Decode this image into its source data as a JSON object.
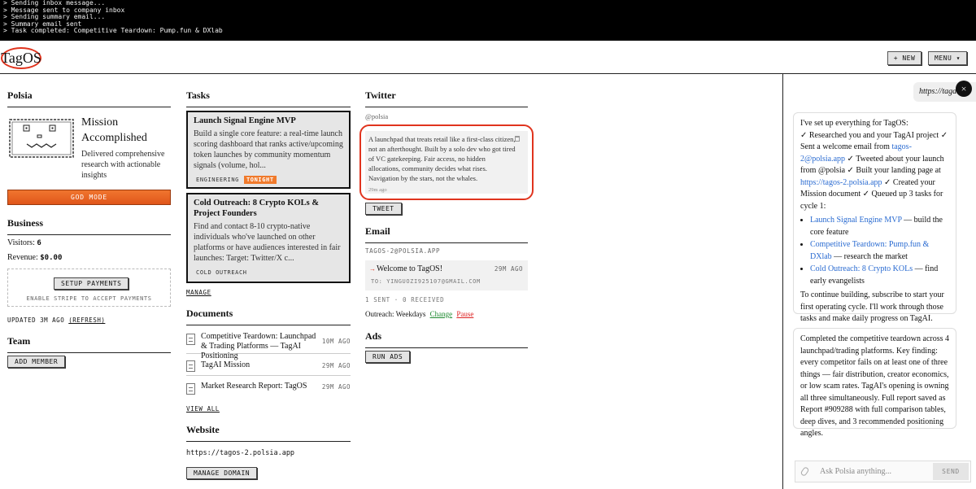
{
  "terminal": {
    "lines": [
      "> Sending inbox message...",
      "> Message sent to company inbox",
      "> Sending summary email...",
      "> Summary email sent",
      "> Task completed: Competitive Teardown: Pump.fun & DXlab"
    ]
  },
  "header": {
    "logo": "TagOS",
    "new_label": "+ NEW",
    "menu_label": "MENU ▾"
  },
  "polsia": {
    "title": "Polsia",
    "mission_title": "Mission Accomplished",
    "mission_desc": "Delivered comprehensive research with actionable insights",
    "god_mode_label": "GOD MODE"
  },
  "business": {
    "title": "Business",
    "visitors_label": "Visitors:",
    "visitors_value": "6",
    "revenue_label": "Revenue:",
    "revenue_value": "$0.00",
    "setup_payments_label": "SETUP PAYMENTS",
    "stripe_text": "ENABLE STRIPE TO ACCEPT PAYMENTS",
    "updated_text": "UPDATED 3M AGO",
    "refresh_label": "(REFRESH)"
  },
  "team": {
    "title": "Team",
    "add_member_label": "ADD MEMBER"
  },
  "tasks": {
    "title": "Tasks",
    "items": [
      {
        "title": "Launch Signal Engine MVP",
        "desc": "Build a single core feature: a real-time launch scoring dashboard that ranks active/upcoming token launches by community momentum signals (volume, hol...",
        "tag1": "ENGINEERING",
        "tag2": "TONIGHT"
      },
      {
        "title": "Cold Outreach: 8 Crypto KOLs & Project Founders",
        "desc": "Find and contact 8-10 crypto-native individuals who've launched on other platforms or have audiences interested in fair launches: Target: Twitter/X c...",
        "tag1": "COLD OUTREACH"
      }
    ],
    "manage_label": "MANAGE"
  },
  "documents": {
    "title": "Documents",
    "items": [
      {
        "name": "Competitive Teardown: Launchpad & Trading Platforms — TagAI Positioning",
        "time": "10M AGO"
      },
      {
        "name": "TagAI Mission",
        "time": "29M AGO"
      },
      {
        "name": "Market Research Report: TagOS",
        "time": "29M AGO"
      }
    ],
    "view_all_label": "VIEW ALL"
  },
  "website": {
    "title": "Website",
    "url": "https://tagos-2.polsia.app",
    "manage_domain_label": "MANAGE DOMAIN"
  },
  "twitter": {
    "title": "Twitter",
    "handle": "@polsia",
    "tweet_text": "A launchpad that treats retail like a first-class citizen, not an afterthought. Built by a solo dev who got tired of VC gatekeeping. Fair access, no hidden allocations, community decides what rises. Navigation by the stars, not the whales.",
    "tweet_time": "29m ago",
    "tweet_label": "TWEET"
  },
  "email": {
    "title": "Email",
    "address": "TAGOS-2@POLSIA.APP",
    "subject": "Welcome to TagOS!",
    "time": "29M AGO",
    "to": "TO: YINGUOZI925107@GMAIL.COM",
    "stats": "1 SENT · 0 RECEIVED",
    "outreach_label": "Outreach: Weekdays",
    "change_label": "Change",
    "pause_label": "Pause"
  },
  "ads": {
    "title": "Ads",
    "run_ads_label": "RUN ADS"
  },
  "chat": {
    "url_pill": "https://tagai",
    "close_label": "×",
    "msg1": {
      "intro": "I've set up everything for TagOS:",
      "body_a": "✓ Researched you and your TagAI project ✓ Sent a welcome email from ",
      "link_email": "tagos-2@polsia.app",
      "body_b": " ✓ Tweeted about your launch from @polsia ✓ Built your landing page at ",
      "link_site": "https://tagos-2.polsia.app",
      "body_c": " ✓ Created your Mission document ✓ Queued up 3 tasks for cycle 1:",
      "list": [
        {
          "link": "Launch Signal Engine MVP",
          "rest": " — build the core feature"
        },
        {
          "link": "Competitive Teardown: Pump.fun & DXlab",
          "rest": " — research the market"
        },
        {
          "link": "Cold Outreach: 8 Crypto KOLs",
          "rest": " — find early evangelists"
        }
      ],
      "outro": "To continue building, subscribe to start your first operating cycle. I'll work through those tasks and make daily progress on TagAI."
    },
    "msg2": "Completed the competitive teardown across 4 launchpad/trading platforms. Key finding: every competitor fails on at least one of three things — fair distribution, creator economics, or low scam rates. TagAI's opening is owning all three simultaneously. Full report saved as Report #909288 with full comparison tables, deep dives, and 3 recommended positioning angles.",
    "input_placeholder": "Ask Polsia anything...",
    "send_label": "SEND"
  },
  "colors": {
    "accent_orange": "#e8621f",
    "highlight_red": "#e0341e",
    "link_blue": "#2a6bd1"
  }
}
